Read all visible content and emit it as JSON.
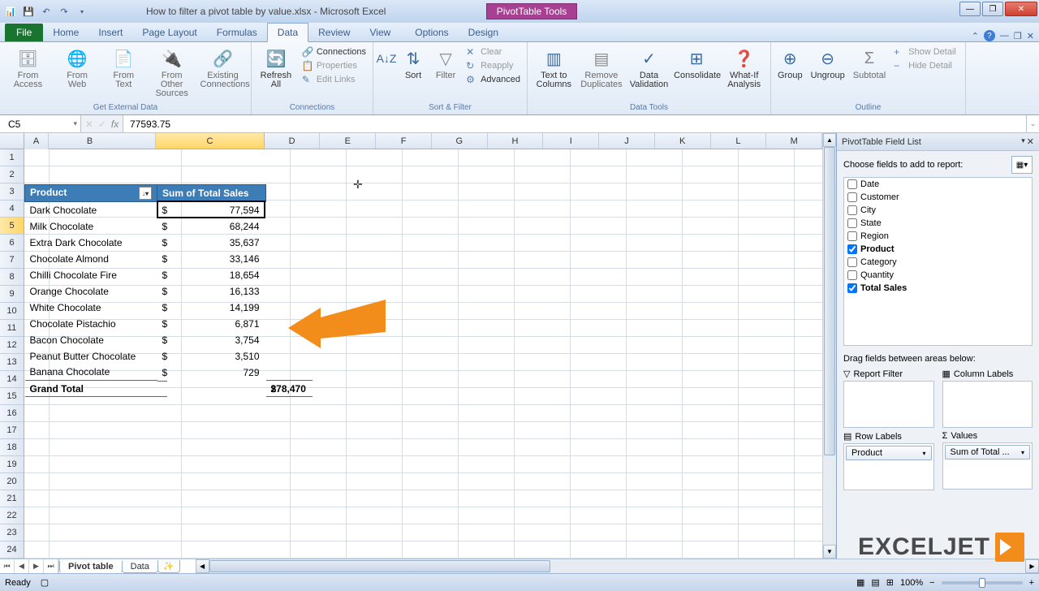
{
  "title": {
    "file": "How to filter a pivot table by value.xlsx - Microsoft Excel",
    "tools": "PivotTable Tools"
  },
  "tabs": [
    "File",
    "Home",
    "Insert",
    "Page Layout",
    "Formulas",
    "Data",
    "Review",
    "View",
    "Options",
    "Design"
  ],
  "active_tab": "Data",
  "ribbon": {
    "get_data": {
      "label": "Get External Data",
      "btns": [
        "From Access",
        "From Web",
        "From Text",
        "From Other Sources",
        "Existing Connections"
      ]
    },
    "connections": {
      "label": "Connections",
      "refresh": "Refresh All",
      "items": [
        "Connections",
        "Properties",
        "Edit Links"
      ]
    },
    "sort_filter": {
      "label": "Sort & Filter",
      "sort": "Sort",
      "filter": "Filter",
      "items": [
        "Clear",
        "Reapply",
        "Advanced"
      ]
    },
    "data_tools": {
      "label": "Data Tools",
      "btns": [
        "Text to Columns",
        "Remove Duplicates",
        "Data Validation",
        "Consolidate",
        "What-If Analysis"
      ]
    },
    "outline": {
      "label": "Outline",
      "btns": [
        "Group",
        "Ungroup",
        "Subtotal"
      ],
      "items": [
        "Show Detail",
        "Hide Detail"
      ]
    }
  },
  "namebox": "C5",
  "formula": "77593.75",
  "columns": [
    "A",
    "B",
    "C",
    "D",
    "E",
    "F",
    "G",
    "H",
    "I",
    "J",
    "K",
    "L",
    "M"
  ],
  "selected_col": "C",
  "selected_row": 5,
  "pivot": {
    "headers": [
      "Product",
      "Sum of Total Sales"
    ],
    "rows": [
      {
        "label": "Dark Chocolate",
        "value": "77,594"
      },
      {
        "label": "Milk Chocolate",
        "value": "68,244"
      },
      {
        "label": "Extra Dark Chocolate",
        "value": "35,637"
      },
      {
        "label": "Chocolate Almond",
        "value": "33,146"
      },
      {
        "label": "Chilli Chocolate Fire",
        "value": "18,654"
      },
      {
        "label": "Orange Chocolate",
        "value": "16,133"
      },
      {
        "label": "White Chocolate",
        "value": "14,199"
      },
      {
        "label": "Chocolate Pistachio",
        "value": "6,871"
      },
      {
        "label": "Bacon Chocolate",
        "value": "3,754"
      },
      {
        "label": "Peanut Butter Chocolate",
        "value": "3,510"
      },
      {
        "label": "Banana Chocolate",
        "value": "729"
      }
    ],
    "total": {
      "label": "Grand Total",
      "value": "278,470"
    },
    "currency": "$"
  },
  "field_list": {
    "title": "PivotTable Field List",
    "prompt": "Choose fields to add to report:",
    "fields": [
      {
        "name": "Date",
        "checked": false
      },
      {
        "name": "Customer",
        "checked": false
      },
      {
        "name": "City",
        "checked": false
      },
      {
        "name": "State",
        "checked": false
      },
      {
        "name": "Region",
        "checked": false
      },
      {
        "name": "Product",
        "checked": true
      },
      {
        "name": "Category",
        "checked": false
      },
      {
        "name": "Quantity",
        "checked": false
      },
      {
        "name": "Total Sales",
        "checked": true
      }
    ],
    "drag_prompt": "Drag fields between areas below:",
    "areas": {
      "filter": "Report Filter",
      "columns": "Column Labels",
      "rows": "Row Labels",
      "values": "Values",
      "row_chip": "Product",
      "val_chip": "Sum of Total ..."
    }
  },
  "sheet_tabs": [
    "Pivot table",
    "Data"
  ],
  "active_sheet": "Pivot table",
  "status": "Ready",
  "zoom": "100%",
  "watermark": "EXCELJET"
}
